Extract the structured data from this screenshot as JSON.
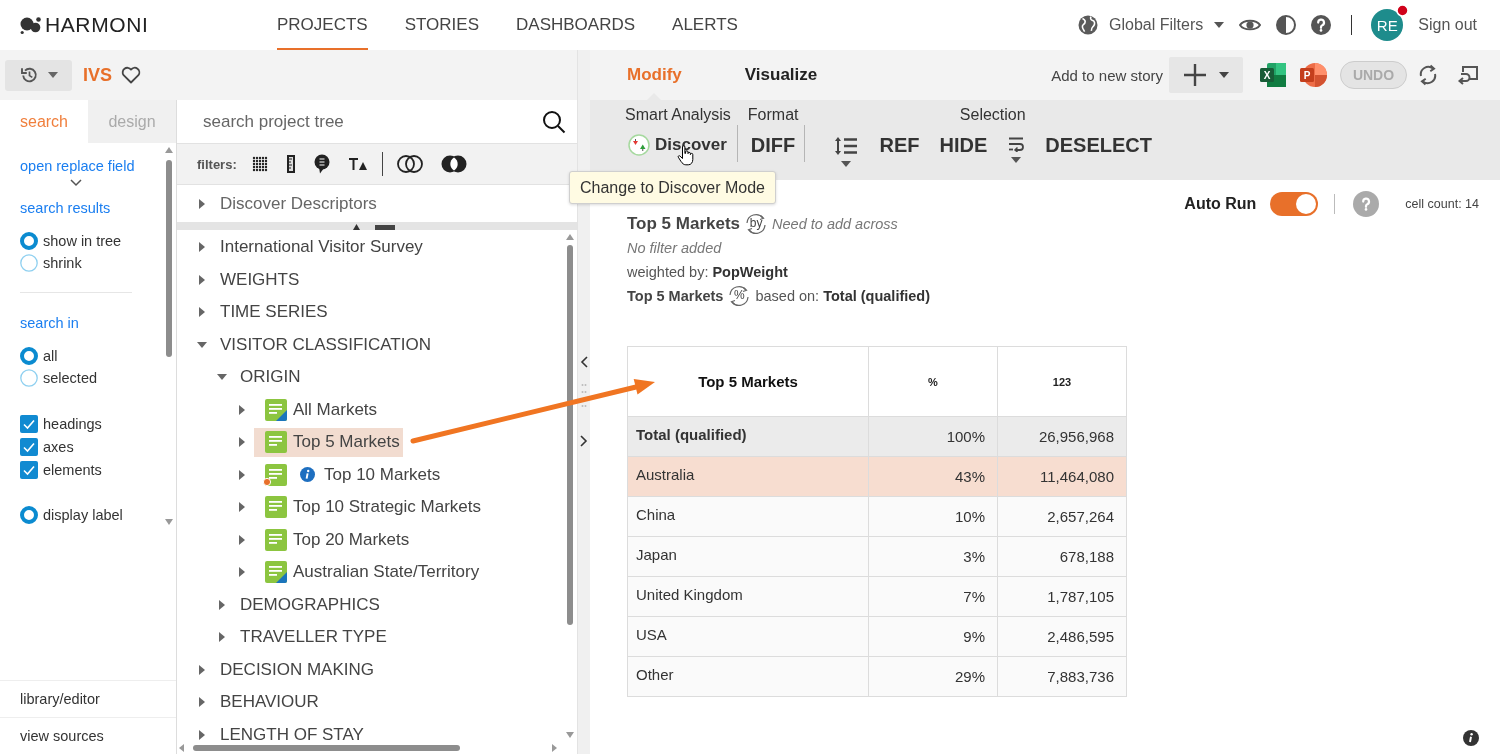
{
  "header": {
    "logo": "HARMONI",
    "nav": [
      {
        "label": "PROJECTS",
        "selected": true
      },
      {
        "label": "STORIES",
        "selected": false
      },
      {
        "label": "DASHBOARDS",
        "selected": false
      },
      {
        "label": "ALERTS",
        "selected": false
      }
    ],
    "global_filters": "Global Filters",
    "user": {
      "initials": "RE",
      "notification": true
    },
    "sign_out": "Sign out"
  },
  "project": {
    "name": "IVS",
    "favorite": false
  },
  "side_tabs": [
    {
      "label": "search",
      "selected": true
    },
    {
      "label": "design",
      "selected": false
    }
  ],
  "search_panel": {
    "replace_link": "open replace field",
    "results_title": "search results",
    "results_options": [
      {
        "label": "show in tree",
        "selected": true
      },
      {
        "label": "shrink",
        "selected": false
      }
    ],
    "scope_title": "search in",
    "scope_options": [
      {
        "label": "all",
        "selected": true
      },
      {
        "label": "selected",
        "selected": false
      }
    ],
    "include_options": [
      {
        "label": "headings",
        "checked": true
      },
      {
        "label": "axes",
        "checked": true
      },
      {
        "label": "elements",
        "checked": true
      }
    ],
    "label_options": [
      {
        "label": "display label",
        "selected": true
      }
    ]
  },
  "side_links": [
    {
      "label": "library/editor"
    },
    {
      "label": "view sources"
    }
  ],
  "tree_search": {
    "placeholder": "search project tree"
  },
  "filters": {
    "label": "filters:"
  },
  "pinned": {
    "label": "Discover Descriptors",
    "expanded": false
  },
  "tree": [
    {
      "kind": "folder",
      "label": "International Visitor Survey",
      "expanded": false,
      "selected": false
    },
    {
      "kind": "folder",
      "label": "WEIGHTS",
      "expanded": false,
      "selected": false
    },
    {
      "kind": "folder",
      "label": "TIME SERIES",
      "expanded": false,
      "selected": false
    },
    {
      "kind": "folder",
      "label": "VISITOR CLASSIFICATION",
      "expanded": true,
      "selected": false,
      "children": [
        {
          "kind": "folder",
          "label": "ORIGIN",
          "expanded": true,
          "selected": false,
          "children": [
            {
              "kind": "custom-table",
              "label": "All Markets",
              "expanded": false,
              "selected": false,
              "info": false
            },
            {
              "kind": "table",
              "label": "Top 5 Markets",
              "expanded": false,
              "selected": true,
              "info": false
            },
            {
              "kind": "flagged-table",
              "label": "Top 10 Markets",
              "expanded": false,
              "selected": false,
              "info": true
            },
            {
              "kind": "table",
              "label": "Top 10 Strategic Markets",
              "expanded": false,
              "selected": false,
              "info": false
            },
            {
              "kind": "table",
              "label": "Top 20 Markets",
              "expanded": false,
              "selected": false,
              "info": false
            },
            {
              "kind": "custom-table",
              "label": "Australian State/Territory",
              "expanded": false,
              "selected": false,
              "info": false
            }
          ]
        },
        {
          "kind": "folder",
          "label": "DEMOGRAPHICS",
          "expanded": false,
          "selected": false
        },
        {
          "kind": "folder",
          "label": "TRAVELLER TYPE",
          "expanded": false,
          "selected": false
        }
      ]
    },
    {
      "kind": "folder",
      "label": "DECISION MAKING",
      "expanded": false,
      "selected": false
    },
    {
      "kind": "folder",
      "label": "BEHAVIOUR",
      "expanded": false,
      "selected": false
    },
    {
      "kind": "folder",
      "label": "LENGTH OF STAY",
      "expanded": false,
      "selected": false
    }
  ],
  "view_tabs": [
    {
      "label": "Modify",
      "selected": true
    },
    {
      "label": "Visualize",
      "selected": false
    }
  ],
  "story": {
    "label": "Add to new story"
  },
  "exports": [
    {
      "kind": "excel",
      "letter": "X"
    },
    {
      "kind": "powerpoint",
      "letter": "P"
    }
  ],
  "undo": {
    "label": "UNDO",
    "disabled": true
  },
  "ribbon": {
    "groups": [
      {
        "label": "Smart Analysis",
        "buttons": [
          {
            "kind": "discover",
            "label": "Discover"
          }
        ]
      },
      {
        "label": "Format",
        "buttons": [
          {
            "kind": "text",
            "label": "DIFF"
          }
        ]
      },
      {
        "label": "Selection",
        "buttons": [
          {
            "kind": "spacing-menu"
          },
          {
            "kind": "text",
            "label": "REF"
          },
          {
            "kind": "text",
            "label": "HIDE"
          },
          {
            "kind": "wrap-menu"
          },
          {
            "kind": "text",
            "label": "DESELECT"
          }
        ]
      }
    ]
  },
  "tooltip": "Change to Discover Mode",
  "summary": {
    "across": {
      "title": "Top 5 Markets",
      "symbol": "by",
      "note": "Need to add across"
    },
    "filter": "No filter added",
    "weight": "weighted by: **PopWeight**",
    "base": {
      "title": "Top 5 Markets",
      "symbol": "%",
      "text": "based on: **Total (qualified)**"
    }
  },
  "auto_run": {
    "label": "Auto Run",
    "on": true
  },
  "cell_count": "cell count: 14",
  "table": {
    "columns": [
      "Top 5 Markets",
      "%",
      "123"
    ],
    "rows": [
      {
        "kind": "total",
        "selected": false,
        "cells": [
          "Total (qualified)",
          "100%",
          "26,956,968"
        ]
      },
      {
        "kind": "data",
        "selected": true,
        "cells": [
          "Australia",
          "43%",
          "11,464,080"
        ]
      },
      {
        "kind": "data",
        "selected": false,
        "cells": [
          "China",
          "10%",
          "2,657,264"
        ]
      },
      {
        "kind": "data",
        "selected": false,
        "cells": [
          "Japan",
          "3%",
          "678,188"
        ]
      },
      {
        "kind": "data",
        "selected": false,
        "cells": [
          "United Kingdom",
          "7%",
          "1,787,105"
        ]
      },
      {
        "kind": "data",
        "selected": false,
        "cells": [
          "USA",
          "9%",
          "2,486,595"
        ]
      },
      {
        "kind": "data",
        "selected": false,
        "cells": [
          "Other",
          "29%",
          "7,883,736"
        ]
      }
    ]
  }
}
